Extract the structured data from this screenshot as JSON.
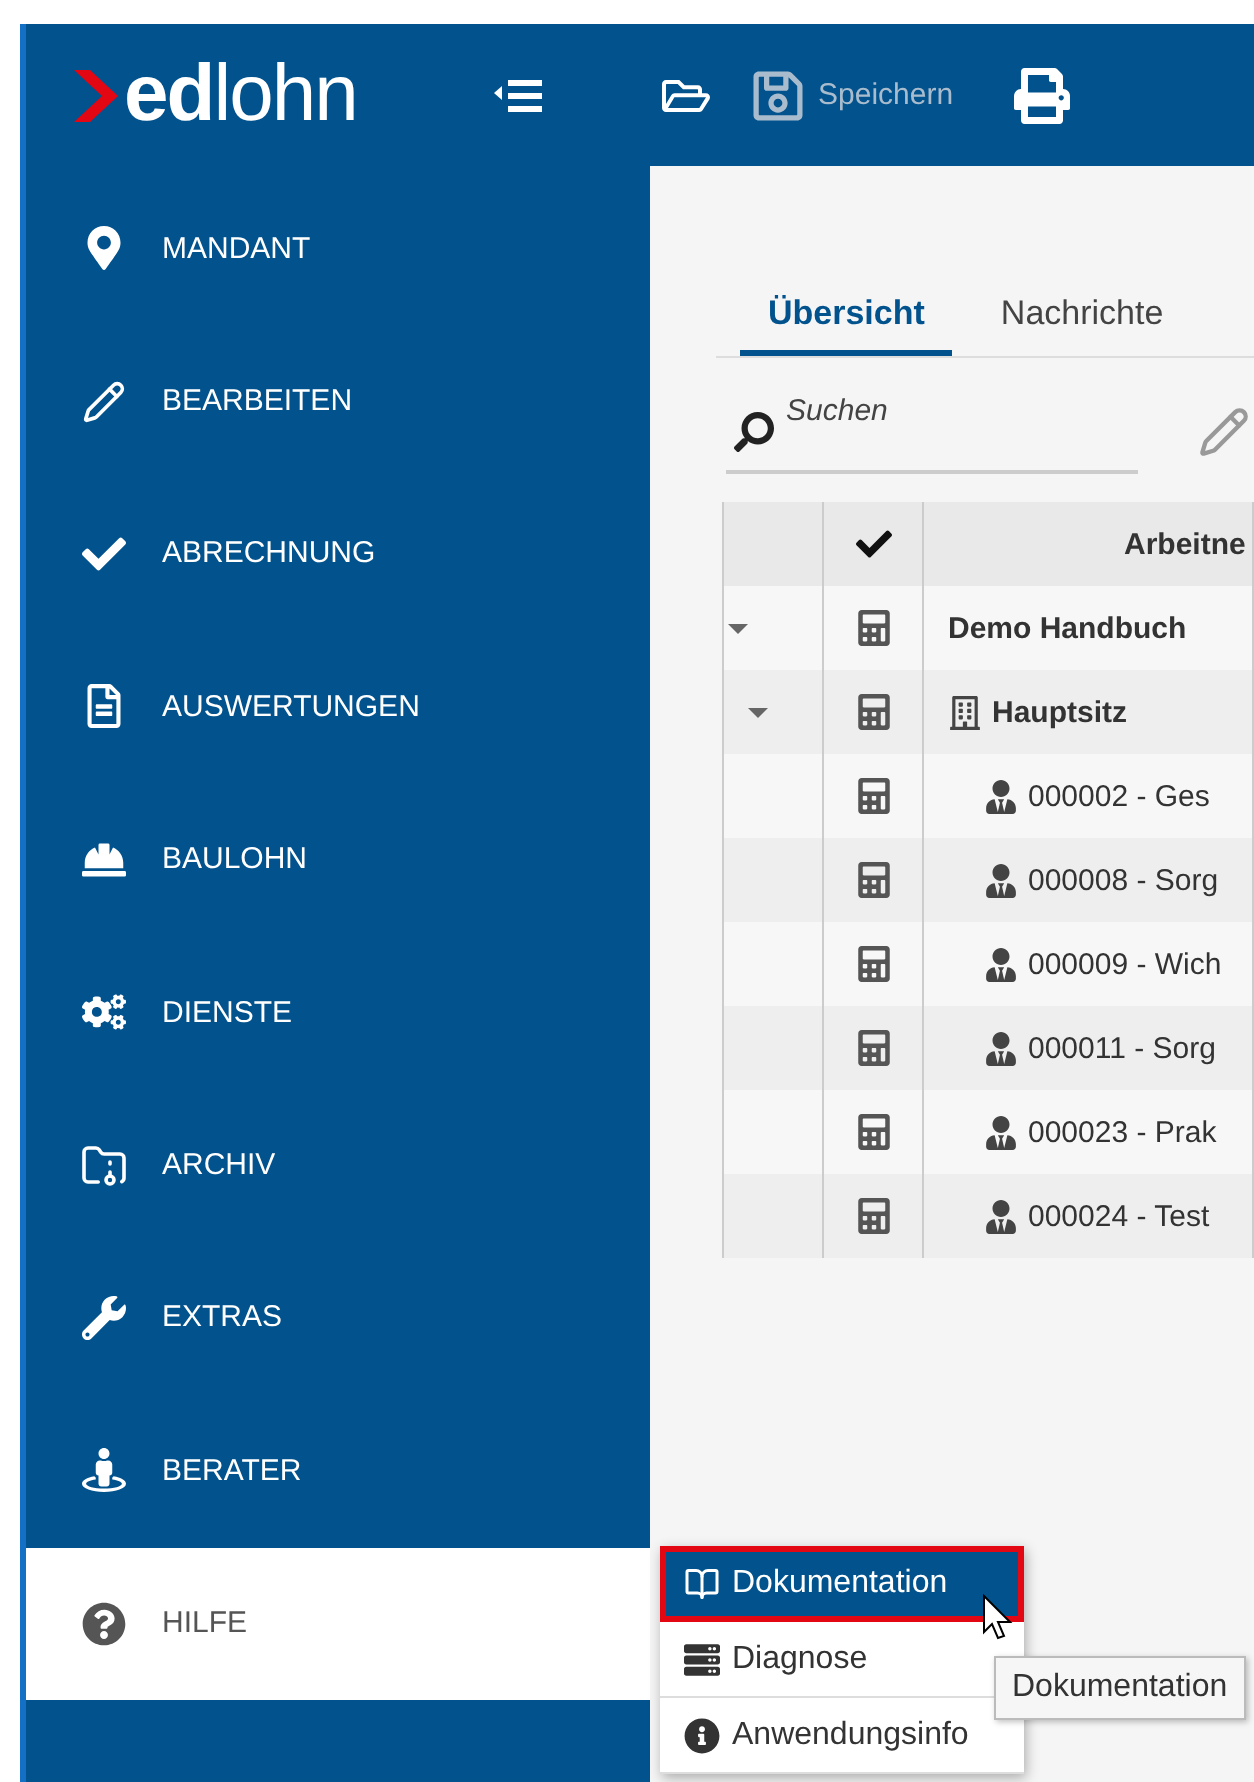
{
  "header": {
    "logo": "**ed**lohn",
    "toolbar": [
      {
        "kind": "collapse"
      },
      {
        "kind": "open"
      },
      {
        "kind": "save",
        "label": "Speichern",
        "disabled": true
      },
      {
        "kind": "print"
      }
    ]
  },
  "sidebar": {
    "items": [
      {
        "label": "MANDANT",
        "selected": false
      },
      {
        "label": "BEARBEITEN",
        "selected": false
      },
      {
        "label": "ABRECHNUNG",
        "selected": false
      },
      {
        "label": "AUSWERTUNGEN",
        "selected": false
      },
      {
        "label": "BAULOHN",
        "selected": false
      },
      {
        "label": "DIENSTE",
        "selected": false
      },
      {
        "label": "ARCHIV",
        "selected": false
      },
      {
        "label": "EXTRAS",
        "selected": false
      },
      {
        "label": "BERATER",
        "selected": false
      },
      {
        "label": "HILFE",
        "selected": true
      }
    ]
  },
  "tabs": [
    {
      "label": "Übersicht",
      "selected": true
    },
    {
      "label": "Nachrichte",
      "selected": false
    }
  ],
  "search": {
    "placeholder": "Suchen"
  },
  "table": {
    "columns": [
      "Arbeitne"
    ],
    "rows": [
      {
        "kind": "company",
        "label": "Demo Handbuch",
        "expanded": true,
        "children": [
          {
            "kind": "site",
            "label": "Hauptsitz",
            "expanded": true,
            "children": [
              {
                "kind": "employee",
                "label": "000002 - Ges"
              },
              {
                "kind": "employee",
                "label": "000008 - Sorg"
              },
              {
                "kind": "employee",
                "label": "000009 - Wich"
              },
              {
                "kind": "employee",
                "label": "000011 - Sorg"
              },
              {
                "kind": "employee",
                "label": "000023 - Prak"
              },
              {
                "kind": "employee",
                "label": "000024 - Test"
              }
            ]
          }
        ]
      }
    ]
  },
  "help_menu": {
    "items": [
      {
        "label": "Dokumentation",
        "selected": true
      },
      {
        "label": "Diagnose",
        "selected": false
      },
      {
        "label": "Anwendungsinfo",
        "selected": false
      }
    ]
  },
  "tooltip": "Dokumentation"
}
